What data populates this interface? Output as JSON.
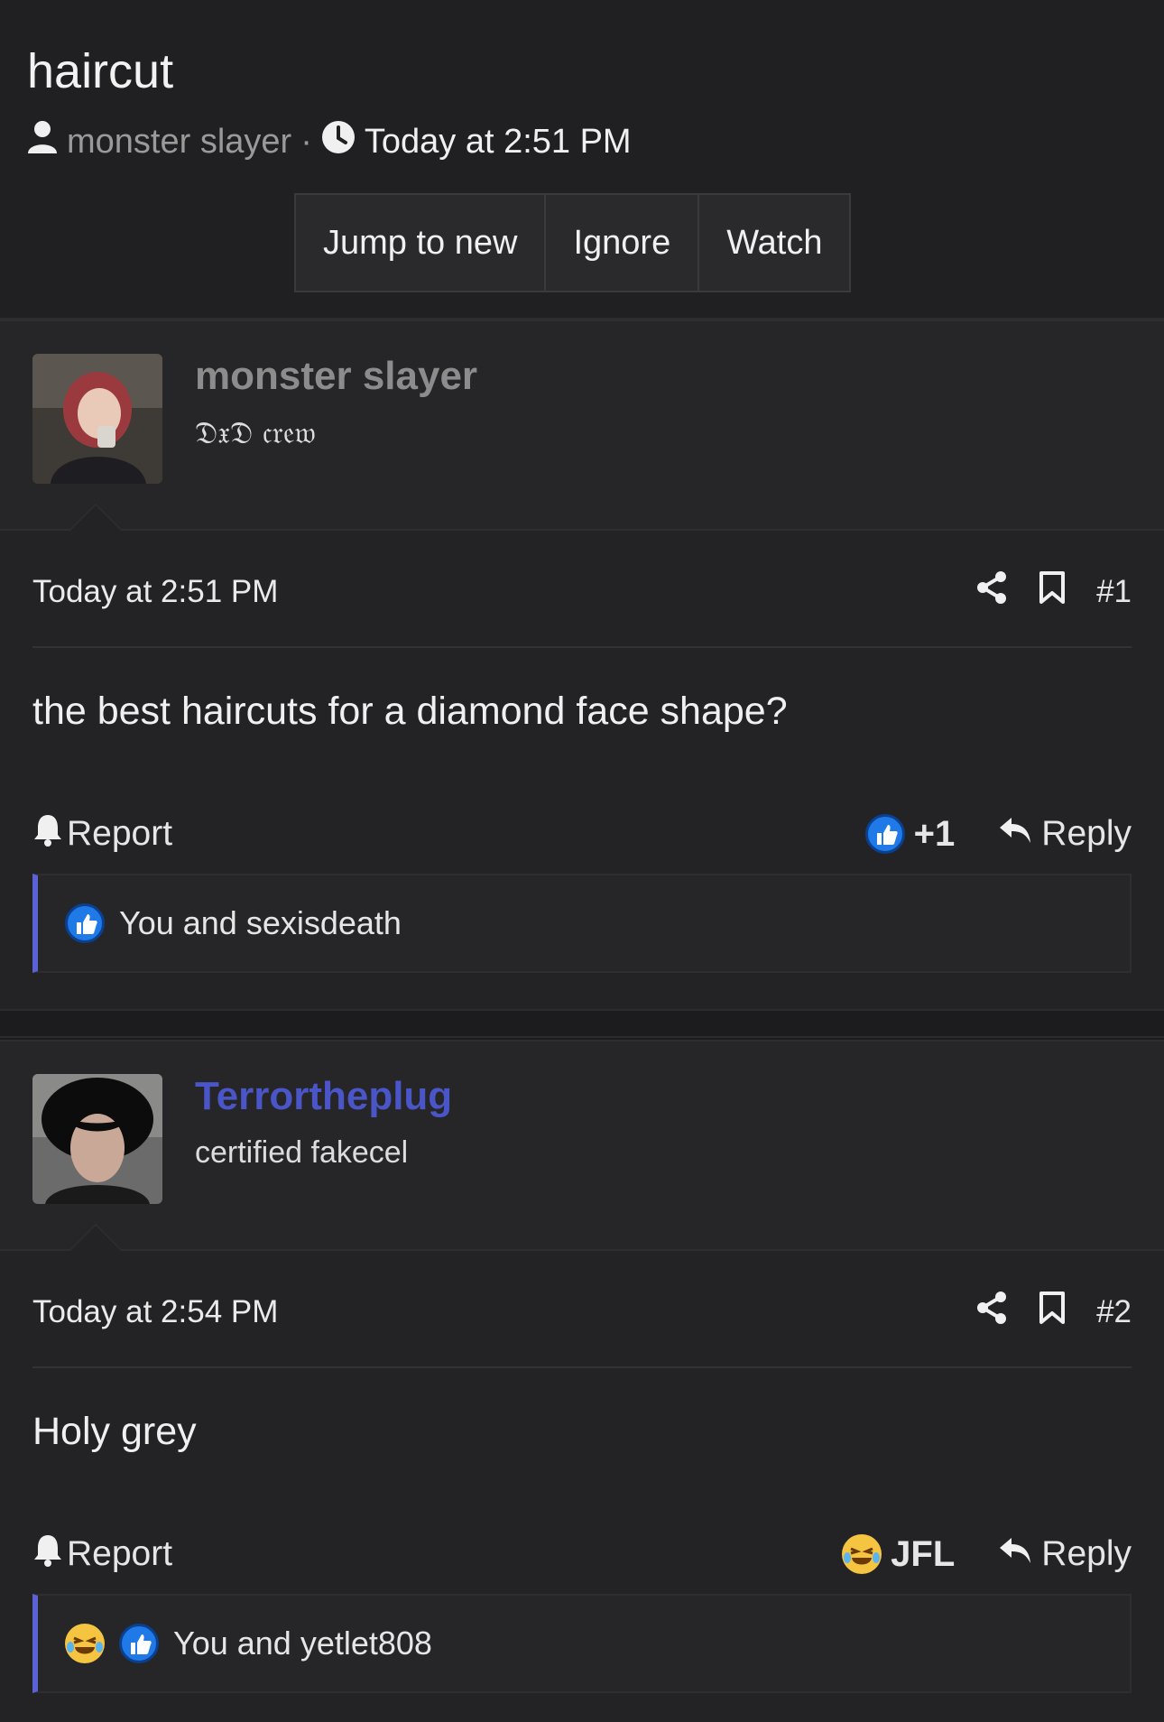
{
  "thread": {
    "title": "haircut",
    "author": "monster slayer",
    "separator": "·",
    "time": "Today at 2:51 PM",
    "buttons": [
      "Jump to new",
      "Ignore",
      "Watch"
    ]
  },
  "posts": [
    {
      "username": "monster slayer",
      "username_color": "#8c8c8c",
      "user_title": "𝔇𝔵𝔇 𝔠𝔯𝔢𝔴",
      "date": "Today at 2:51 PM",
      "number": "#1",
      "message": "the best haircuts for a diamond face shape?",
      "report_label": "Report",
      "reaction_label": "+1",
      "reply_label": "Reply",
      "reactions_summary": "You and sexisdeath"
    },
    {
      "username": "Terrortheplug",
      "username_color": "#4a55c8",
      "user_title": "certified fakecel",
      "date": "Today at 2:54 PM",
      "number": "#2",
      "message": "Holy grey",
      "report_label": "Report",
      "reaction_label": "JFL",
      "reply_label": "Reply",
      "reactions_summary": "You and yetlet808"
    }
  ],
  "icons": {
    "user": "user-icon",
    "clock": "clock-icon",
    "share": "share-icon",
    "bookmark": "bookmark-icon",
    "bell": "bell-icon",
    "reply": "reply-arrow-icon",
    "like": "thumbs-up-icon",
    "haha": "laughing-crying-emoji-icon"
  },
  "colors": {
    "accent": "#5a62d6",
    "like_blue": "#1f7ae8"
  }
}
